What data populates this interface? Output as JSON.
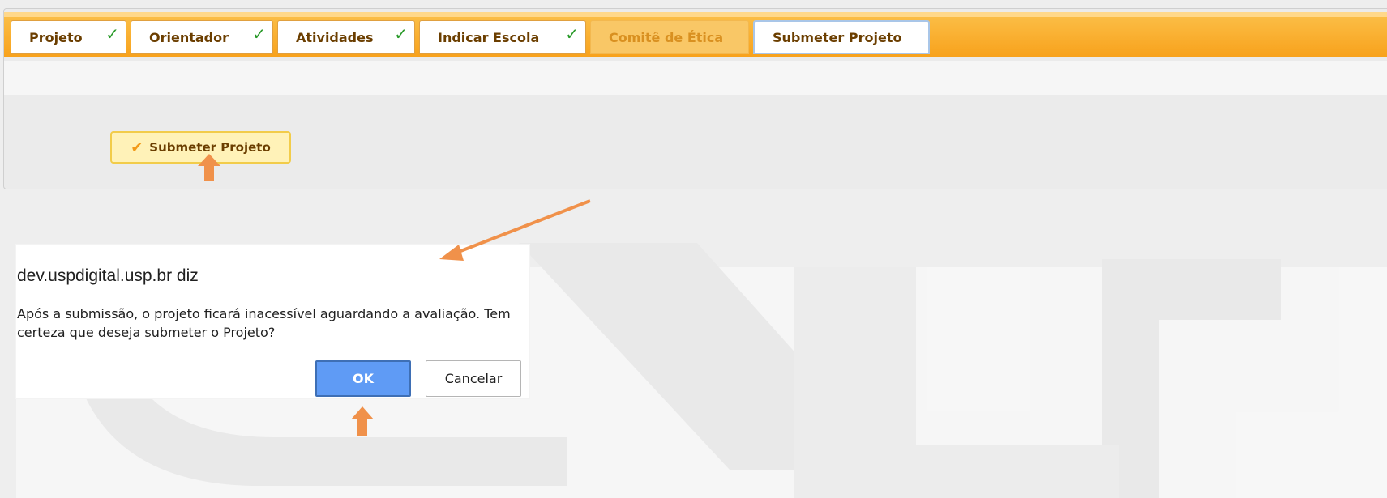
{
  "tabs": [
    {
      "label": "Projeto",
      "completed": true
    },
    {
      "label": "Orientador",
      "completed": true
    },
    {
      "label": "Atividades",
      "completed": true
    },
    {
      "label": "Indicar Escola",
      "completed": true
    },
    {
      "label": "Comitê de Ética",
      "completed": false,
      "disabled": true
    },
    {
      "label": "Submeter Projeto",
      "completed": false,
      "active": true
    }
  ],
  "tick_glyph": "✓",
  "submit_button": {
    "label": "Submeter Projeto",
    "icon": "check-icon"
  },
  "dialog": {
    "title": "dev.uspdigital.usp.br diz",
    "message": "Após a submissão, o projeto ficará inacessível aguardando a avaliação. Tem certeza que deseja submeter o Projeto?",
    "ok_label": "OK",
    "cancel_label": "Cancelar"
  },
  "colors": {
    "tab_bar": "#f8a21c",
    "ok_button": "#5f9bf5",
    "annotation_arrow": "#f0914a",
    "tick": "#2a9a2a"
  }
}
